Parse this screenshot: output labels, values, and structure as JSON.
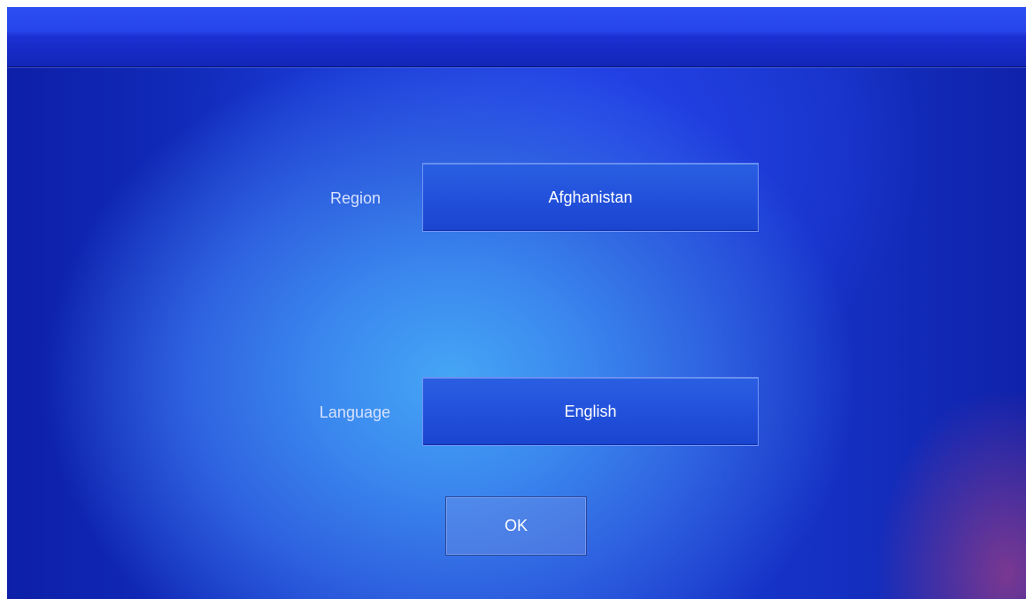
{
  "setup": {
    "region": {
      "label": "Region",
      "value": "Afghanistan"
    },
    "language": {
      "label": "Language",
      "value": "English"
    },
    "ok_label": "OK"
  },
  "colors": {
    "header": "#2745ea",
    "background_center": "#45a6f5",
    "background_edge": "#0d1fa8",
    "corner_glow": "#8c3c8c",
    "button_fill": "#2352dc",
    "label_text": "#d8e2ff",
    "button_text": "#ffffff"
  }
}
